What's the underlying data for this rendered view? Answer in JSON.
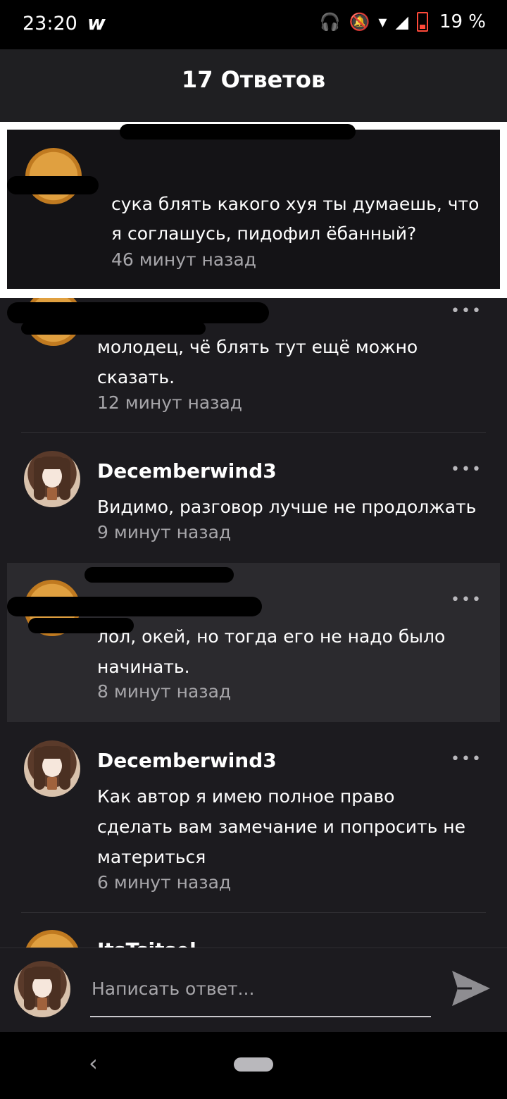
{
  "status_bar": {
    "time": "23:20",
    "app_glyph": "w",
    "battery": "19 %",
    "icons": [
      "headphones-icon",
      "bell-off-icon",
      "wifi-icon",
      "signal-icon",
      "battery-icon"
    ]
  },
  "header": {
    "title": "17 Ответов"
  },
  "parent_comment": {
    "text_line1": "сука блять какого хуя ты думаешь, что",
    "text_line2": "я соглашусь, пидофил ёбанный?",
    "time": "46 минут назад"
  },
  "comments": [
    {
      "username": "",
      "text_line1": "молодец, чё блять тут ещё можно",
      "text_line2": "сказать.",
      "time": "12 минут назад"
    },
    {
      "username": "Decemberwind3",
      "text_line1": "Видимо, разговор лучше не продолжать",
      "time": "9 минут назад"
    },
    {
      "username": "",
      "text_line1": "лол, окей, но тогда его не надо было",
      "text_line2": "начинать.",
      "time": "8 минут назад"
    },
    {
      "username": "Decemberwind3",
      "text_line1": "Как автор я имею полное право",
      "text_line2": "сделать вам замечание и попросить не",
      "text_line3": "материться",
      "time": "6 минут назад"
    },
    {
      "username": "ItsTsitsel"
    }
  ],
  "more_label": "•••",
  "reply": {
    "placeholder": "Написать ответ..."
  },
  "nav": {
    "back": "‹"
  },
  "colors": {
    "background": "#1c1b1f",
    "highlight_border": "#ffffff",
    "secondary_text": "#a7a6aa"
  }
}
